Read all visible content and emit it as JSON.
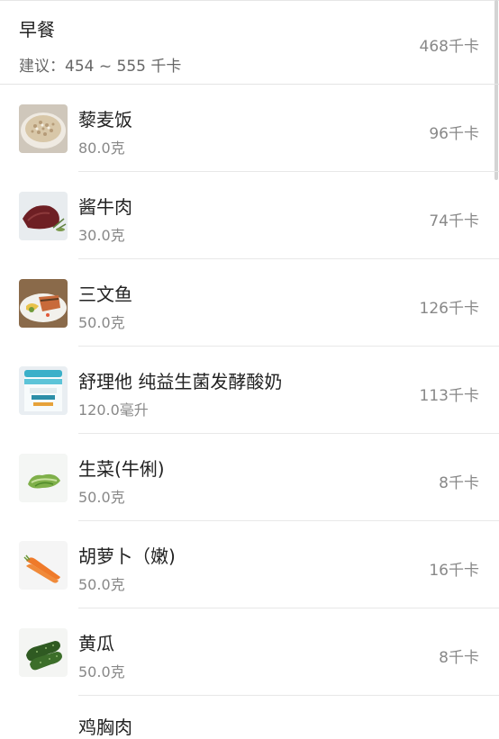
{
  "meal": {
    "title": "早餐",
    "suggestion": "建议：454 ~ 555 千卡",
    "total": "468千卡"
  },
  "foods": [
    {
      "name": "藜麦饭",
      "amount": "80.0克",
      "kcal": "96千卡",
      "icon": "quinoa-rice-image"
    },
    {
      "name": "酱牛肉",
      "amount": "30.0克",
      "kcal": "74千卡",
      "icon": "braised-beef-image"
    },
    {
      "name": "三文鱼",
      "amount": "50.0克",
      "kcal": "126千卡",
      "icon": "salmon-image"
    },
    {
      "name": "舒理他 纯益生菌发酵酸奶",
      "amount": "120.0毫升",
      "kcal": "113千卡",
      "icon": "yogurt-image"
    },
    {
      "name": "生菜(牛俐)",
      "amount": "50.0克",
      "kcal": "8千卡",
      "icon": "lettuce-image"
    },
    {
      "name": "胡萝卜（嫩)",
      "amount": "50.0克",
      "kcal": "16千卡",
      "icon": "carrot-image"
    },
    {
      "name": "黄瓜",
      "amount": "50.0克",
      "kcal": "8千卡",
      "icon": "cucumber-image"
    }
  ],
  "partial_item": {
    "name": "鸡胸肉"
  },
  "colors": {
    "primary_text": "#222222",
    "secondary_text": "#888888",
    "divider": "#e8e8e8"
  }
}
